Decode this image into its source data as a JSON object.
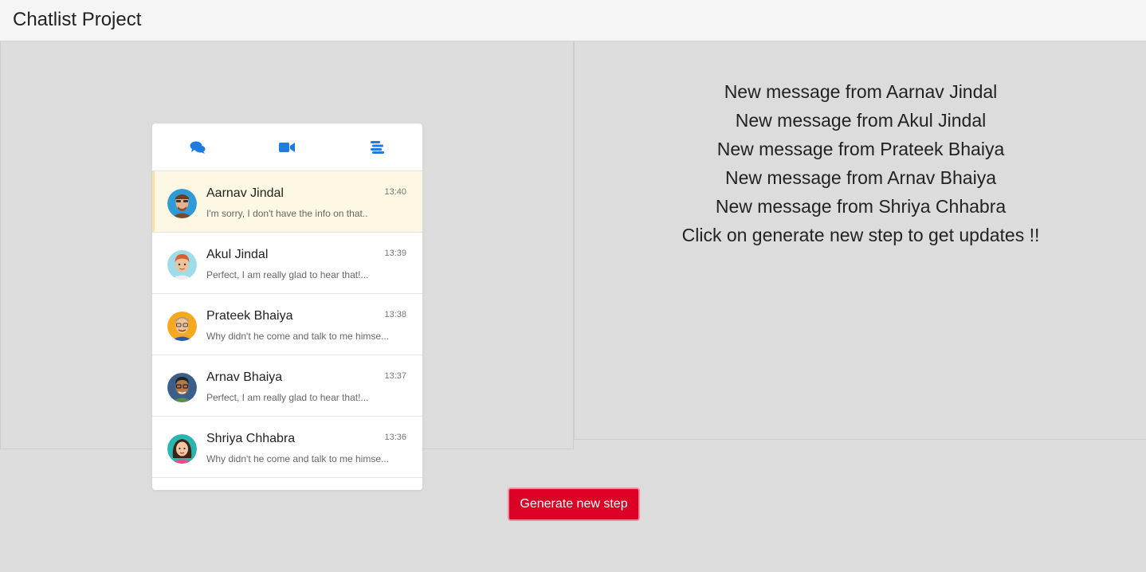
{
  "header": {
    "title": "Chatlist Project"
  },
  "phone": {
    "tabs": [
      {
        "icon": "chat-bubbles-icon"
      },
      {
        "icon": "video-camera-icon"
      },
      {
        "icon": "menu-icon"
      }
    ],
    "chats": [
      {
        "name": "Aarnav Jindal",
        "time": "13:40",
        "preview": "I'm sorry, I don't have the info on that..",
        "active": true
      },
      {
        "name": "Akul Jindal",
        "time": "13:39",
        "preview": "Perfect, I am really glad to hear that!...",
        "active": false
      },
      {
        "name": "Prateek Bhaiya",
        "time": "13:38",
        "preview": "Why didn't he come and talk to me himse...",
        "active": false
      },
      {
        "name": "Arnav Bhaiya",
        "time": "13:37",
        "preview": "Perfect, I am really glad to hear that!...",
        "active": false
      },
      {
        "name": "Shriya Chhabra",
        "time": "13:36",
        "preview": "Why didn't he come and talk to me himse...",
        "active": false
      }
    ]
  },
  "notifications": [
    "New message from Aarnav Jindal",
    "New message from Akul Jindal",
    "New message from Prateek Bhaiya",
    "New message from Arnav Bhaiya",
    "New message from Shriya Chhabra",
    "Click on generate new step to get updates !!"
  ],
  "actions": {
    "generate_label": "Generate new step"
  },
  "colors": {
    "accent_blue": "#1e7be0",
    "button_red": "#dc0024",
    "active_row": "#fdf8e3"
  }
}
